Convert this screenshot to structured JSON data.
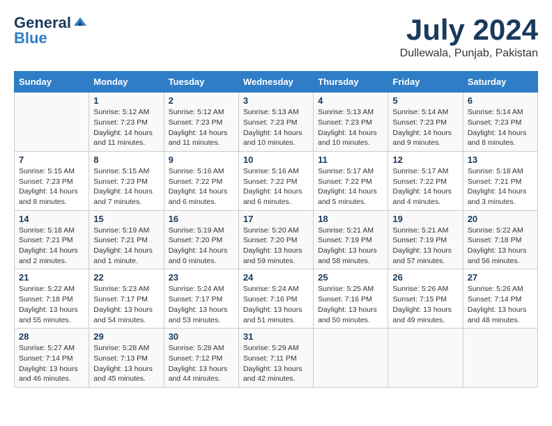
{
  "header": {
    "logo_general": "General",
    "logo_blue": "Blue",
    "month": "July 2024",
    "location": "Dullewala, Punjab, Pakistan"
  },
  "weekdays": [
    "Sunday",
    "Monday",
    "Tuesday",
    "Wednesday",
    "Thursday",
    "Friday",
    "Saturday"
  ],
  "weeks": [
    [
      {
        "day": "",
        "info": ""
      },
      {
        "day": "1",
        "info": "Sunrise: 5:12 AM\nSunset: 7:23 PM\nDaylight: 14 hours\nand 11 minutes."
      },
      {
        "day": "2",
        "info": "Sunrise: 5:12 AM\nSunset: 7:23 PM\nDaylight: 14 hours\nand 11 minutes."
      },
      {
        "day": "3",
        "info": "Sunrise: 5:13 AM\nSunset: 7:23 PM\nDaylight: 14 hours\nand 10 minutes."
      },
      {
        "day": "4",
        "info": "Sunrise: 5:13 AM\nSunset: 7:23 PM\nDaylight: 14 hours\nand 10 minutes."
      },
      {
        "day": "5",
        "info": "Sunrise: 5:14 AM\nSunset: 7:23 PM\nDaylight: 14 hours\nand 9 minutes."
      },
      {
        "day": "6",
        "info": "Sunrise: 5:14 AM\nSunset: 7:23 PM\nDaylight: 14 hours\nand 8 minutes."
      }
    ],
    [
      {
        "day": "7",
        "info": "Sunrise: 5:15 AM\nSunset: 7:23 PM\nDaylight: 14 hours\nand 8 minutes."
      },
      {
        "day": "8",
        "info": "Sunrise: 5:15 AM\nSunset: 7:23 PM\nDaylight: 14 hours\nand 7 minutes."
      },
      {
        "day": "9",
        "info": "Sunrise: 5:16 AM\nSunset: 7:22 PM\nDaylight: 14 hours\nand 6 minutes."
      },
      {
        "day": "10",
        "info": "Sunrise: 5:16 AM\nSunset: 7:22 PM\nDaylight: 14 hours\nand 6 minutes."
      },
      {
        "day": "11",
        "info": "Sunrise: 5:17 AM\nSunset: 7:22 PM\nDaylight: 14 hours\nand 5 minutes."
      },
      {
        "day": "12",
        "info": "Sunrise: 5:17 AM\nSunset: 7:22 PM\nDaylight: 14 hours\nand 4 minutes."
      },
      {
        "day": "13",
        "info": "Sunrise: 5:18 AM\nSunset: 7:21 PM\nDaylight: 14 hours\nand 3 minutes."
      }
    ],
    [
      {
        "day": "14",
        "info": "Sunrise: 5:18 AM\nSunset: 7:21 PM\nDaylight: 14 hours\nand 2 minutes."
      },
      {
        "day": "15",
        "info": "Sunrise: 5:19 AM\nSunset: 7:21 PM\nDaylight: 14 hours\nand 1 minute."
      },
      {
        "day": "16",
        "info": "Sunrise: 5:19 AM\nSunset: 7:20 PM\nDaylight: 14 hours\nand 0 minutes."
      },
      {
        "day": "17",
        "info": "Sunrise: 5:20 AM\nSunset: 7:20 PM\nDaylight: 13 hours\nand 59 minutes."
      },
      {
        "day": "18",
        "info": "Sunrise: 5:21 AM\nSunset: 7:19 PM\nDaylight: 13 hours\nand 58 minutes."
      },
      {
        "day": "19",
        "info": "Sunrise: 5:21 AM\nSunset: 7:19 PM\nDaylight: 13 hours\nand 57 minutes."
      },
      {
        "day": "20",
        "info": "Sunrise: 5:22 AM\nSunset: 7:18 PM\nDaylight: 13 hours\nand 56 minutes."
      }
    ],
    [
      {
        "day": "21",
        "info": "Sunrise: 5:22 AM\nSunset: 7:18 PM\nDaylight: 13 hours\nand 55 minutes."
      },
      {
        "day": "22",
        "info": "Sunrise: 5:23 AM\nSunset: 7:17 PM\nDaylight: 13 hours\nand 54 minutes."
      },
      {
        "day": "23",
        "info": "Sunrise: 5:24 AM\nSunset: 7:17 PM\nDaylight: 13 hours\nand 53 minutes."
      },
      {
        "day": "24",
        "info": "Sunrise: 5:24 AM\nSunset: 7:16 PM\nDaylight: 13 hours\nand 51 minutes."
      },
      {
        "day": "25",
        "info": "Sunrise: 5:25 AM\nSunset: 7:16 PM\nDaylight: 13 hours\nand 50 minutes."
      },
      {
        "day": "26",
        "info": "Sunrise: 5:26 AM\nSunset: 7:15 PM\nDaylight: 13 hours\nand 49 minutes."
      },
      {
        "day": "27",
        "info": "Sunrise: 5:26 AM\nSunset: 7:14 PM\nDaylight: 13 hours\nand 48 minutes."
      }
    ],
    [
      {
        "day": "28",
        "info": "Sunrise: 5:27 AM\nSunset: 7:14 PM\nDaylight: 13 hours\nand 46 minutes."
      },
      {
        "day": "29",
        "info": "Sunrise: 5:28 AM\nSunset: 7:13 PM\nDaylight: 13 hours\nand 45 minutes."
      },
      {
        "day": "30",
        "info": "Sunrise: 5:28 AM\nSunset: 7:12 PM\nDaylight: 13 hours\nand 44 minutes."
      },
      {
        "day": "31",
        "info": "Sunrise: 5:29 AM\nSunset: 7:11 PM\nDaylight: 13 hours\nand 42 minutes."
      },
      {
        "day": "",
        "info": ""
      },
      {
        "day": "",
        "info": ""
      },
      {
        "day": "",
        "info": ""
      }
    ]
  ]
}
